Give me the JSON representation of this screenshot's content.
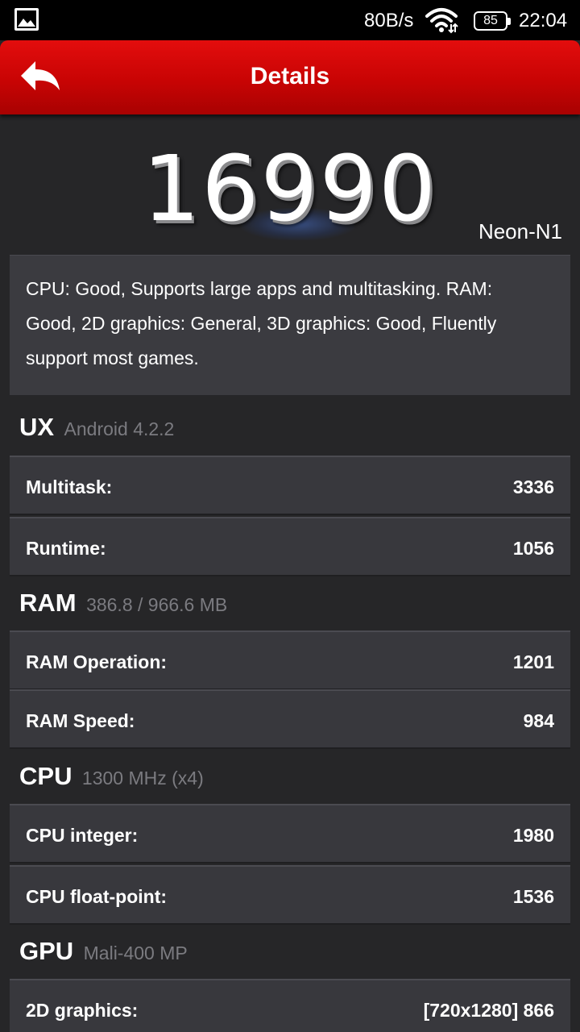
{
  "status_bar": {
    "speed": "80B/s",
    "battery": "85",
    "time": "22:04",
    "icons": [
      "gallery-icon",
      "wifi-icon",
      "battery-icon"
    ]
  },
  "header": {
    "title": "Details",
    "back_icon": "back-arrow-icon",
    "accent_color": "#d00505"
  },
  "score": {
    "value": "16990",
    "device": "Neon-N1"
  },
  "summary": "CPU: Good, Supports large apps and multitasking. RAM: Good, 2D graphics: General, 3D graphics: Good, Fluently support most games.",
  "sections": [
    {
      "title": "UX",
      "subtitle": "Android 4.2.2",
      "rows": [
        {
          "label": "Multitask:",
          "value": "3336"
        },
        {
          "label": "Runtime:",
          "value": "1056"
        }
      ]
    },
    {
      "title": "RAM",
      "subtitle": "386.8 / 966.6 MB",
      "rows": [
        {
          "label": "RAM Operation:",
          "value": "1201"
        },
        {
          "label": "RAM Speed:",
          "value": "984"
        }
      ]
    },
    {
      "title": "CPU",
      "subtitle": "1300 MHz (x4)",
      "rows": [
        {
          "label": "CPU integer:",
          "value": "1980"
        },
        {
          "label": "CPU float-point:",
          "value": "1536"
        }
      ]
    },
    {
      "title": "GPU",
      "subtitle": "Mali-400 MP",
      "rows": [
        {
          "label": "2D graphics:",
          "value": "[720x1280] 866"
        }
      ]
    }
  ]
}
